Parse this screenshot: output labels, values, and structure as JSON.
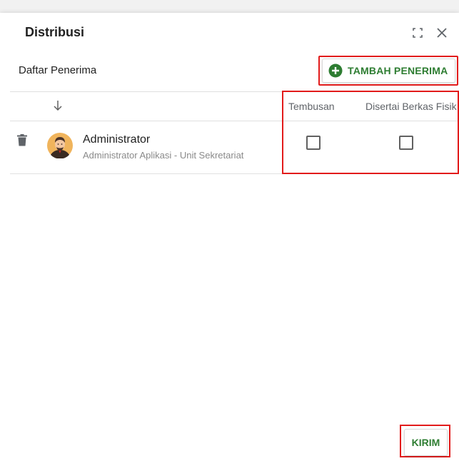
{
  "dialog": {
    "title": "Distribusi",
    "fullscreen_icon": "fullscreen-icon",
    "close_icon": "close-icon"
  },
  "recipients": {
    "label": "Daftar Penerima",
    "add_button_label": "TAMBAH PENERIMA",
    "add_icon": "plus-circle-icon"
  },
  "table": {
    "sort_icon": "arrow-down-icon",
    "columns": [
      "Tembusan",
      "Disertai Berkas Fisik"
    ],
    "rows": [
      {
        "name": "Administrator",
        "subtitle": "Administrator Aplikasi - Unit Sekretariat",
        "tembusan": false,
        "berkas_fisik": false
      }
    ]
  },
  "footer": {
    "send_label": "KIRIM"
  },
  "colors": {
    "accent_green": "#2e7d32",
    "highlight_red": "#e21b1b"
  }
}
